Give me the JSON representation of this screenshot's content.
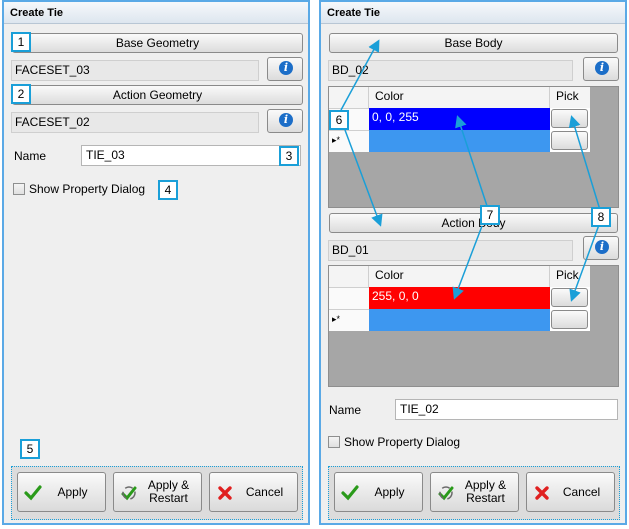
{
  "left_panel": {
    "title": "Create Tie",
    "base_button": "Base Geometry",
    "base_value": "FACESET_03",
    "action_button": "Action Geometry",
    "action_value": "FACESET_02",
    "name_label": "Name",
    "name_value": "TIE_03",
    "checkbox_label": "Show Property Dialog",
    "apply": "Apply",
    "apply_restart_1": "Apply &",
    "apply_restart_2": "Restart",
    "cancel": "Cancel"
  },
  "right_panel": {
    "title": "Create Tie",
    "base_button": "Base Body",
    "base_value": "BD_02",
    "grid1": {
      "col_color": "Color",
      "col_pick": "Pick",
      "row1_value": "0, 0, 255",
      "row1_color": "#0000ff",
      "row2_color": "#3d97f0",
      "new_row_marker": "▸*"
    },
    "action_button": "Action Body",
    "action_value": "BD_01",
    "grid2": {
      "col_color": "Color",
      "col_pick": "Pick",
      "row1_value": "255, 0, 0",
      "row1_color": "#ff0000",
      "row2_color": "#3d97f0",
      "new_row_marker": "▸*"
    },
    "name_label": "Name",
    "name_value": "TIE_02",
    "checkbox_label": "Show Property Dialog",
    "apply": "Apply",
    "apply_restart_1": "Apply &",
    "apply_restart_2": "Restart",
    "cancel": "Cancel"
  },
  "callouts": {
    "c1": "1",
    "c2": "2",
    "c3": "3",
    "c4": "4",
    "c5": "5",
    "c6": "6",
    "c7": "7",
    "c8": "8"
  },
  "colors": {
    "callout": "#1a9fd8",
    "panel_border": "#5aa9e6",
    "info": "#1c6ec8"
  }
}
